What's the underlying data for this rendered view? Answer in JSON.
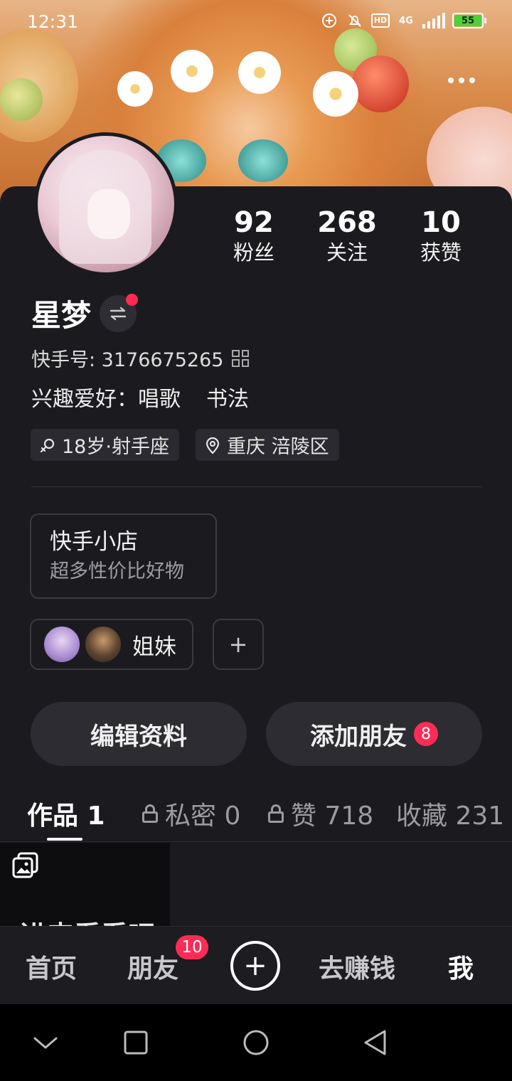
{
  "status_bar": {
    "time": "12:31",
    "network": "4G",
    "battery": "55",
    "hd_label": "HD"
  },
  "profile": {
    "name": "星梦",
    "kuaishou_id": "快手号: 3176675265",
    "hobbies_label": "兴趣爱好：",
    "hobbies": [
      "唱歌",
      "书法"
    ],
    "tags": [
      {
        "icon": "gender-female-icon",
        "text": "18岁·射手座"
      },
      {
        "icon": "location-pin-icon",
        "text": "重庆 涪陵区"
      }
    ]
  },
  "stats": [
    {
      "value": "92",
      "label": "粉丝"
    },
    {
      "value": "268",
      "label": "关注"
    },
    {
      "value": "10",
      "label": "获赞"
    }
  ],
  "shop": {
    "title": "快手小店",
    "subtitle": "超多性价比好物"
  },
  "group": {
    "name": "姐妹",
    "add_symbol": "+"
  },
  "actions": {
    "edit_profile": "编辑资料",
    "add_friends": "添加朋友",
    "add_friends_badge": "8"
  },
  "tabs": [
    {
      "label": "作品 1",
      "locked": false,
      "active": true
    },
    {
      "label": "私密 0",
      "locked": true,
      "active": false
    },
    {
      "label": "赞 718",
      "locked": true,
      "active": false
    },
    {
      "label": "收藏 231",
      "locked": false,
      "active": false
    }
  ],
  "works": [
    {
      "caption": "进来看看吧",
      "type": "photo-album"
    }
  ],
  "bottom_nav": {
    "items": [
      "首页",
      "朋友",
      "去赚钱",
      "我"
    ],
    "friends_badge": "10",
    "create_symbol": "+"
  },
  "colors": {
    "accent_red": "#fe2c55",
    "background": "#1b1b1f",
    "battery_green": "#4cd137"
  }
}
